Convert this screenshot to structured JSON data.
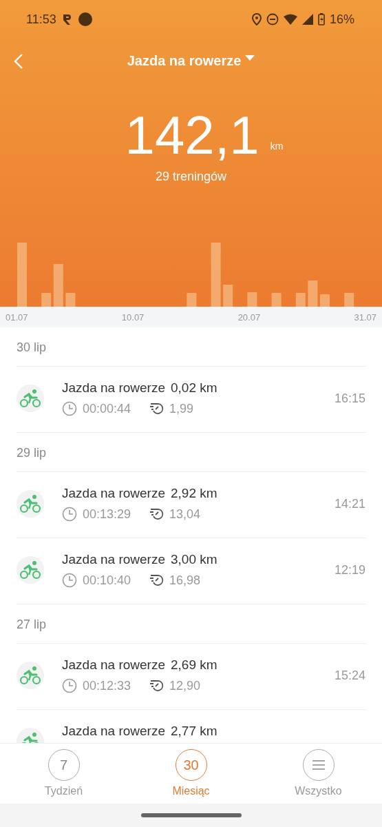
{
  "status_bar": {
    "time": "11:53",
    "battery": "16%"
  },
  "header": {
    "title": "Jazda na rowerze",
    "total": "142,1",
    "unit": "km",
    "workouts": "29 treningów"
  },
  "chart": {
    "axis_labels": [
      "01.07",
      "10.07",
      "20.07",
      "31.07"
    ]
  },
  "groups": [
    {
      "date": "30 lip",
      "sessions": [
        {
          "name": "Jazda na rowerze",
          "distance": "0,02 km",
          "duration": "00:00:44",
          "speed": "1,99",
          "time": "16:15"
        }
      ]
    },
    {
      "date": "29 lip",
      "sessions": [
        {
          "name": "Jazda na rowerze",
          "distance": "2,92 km",
          "duration": "00:13:29",
          "speed": "13,04",
          "time": "14:21"
        },
        {
          "name": "Jazda na rowerze",
          "distance": "3,00 km",
          "duration": "00:10:40",
          "speed": "16,98",
          "time": "12:19"
        }
      ]
    },
    {
      "date": "27 lip",
      "sessions": [
        {
          "name": "Jazda na rowerze",
          "distance": "2,69 km",
          "duration": "00:12:33",
          "speed": "12,90",
          "time": "15:24"
        },
        {
          "name": "Jazda na rowerze",
          "distance": "2,77 km"
        }
      ]
    }
  ],
  "nav": [
    {
      "kind": "number",
      "badge": "7",
      "label": "Tydzień",
      "selected": false
    },
    {
      "kind": "number",
      "badge": "30",
      "label": "Miesiąc",
      "selected": true
    },
    {
      "kind": "menu",
      "label": "Wszystko",
      "selected": false
    }
  ]
}
